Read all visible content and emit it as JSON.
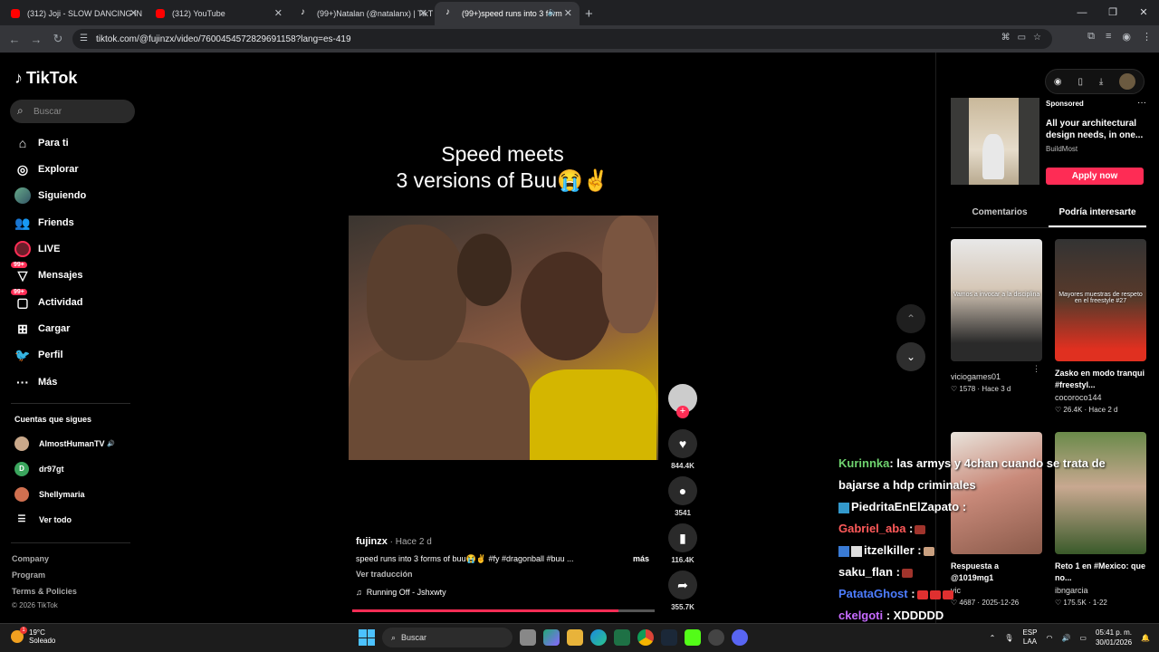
{
  "browser": {
    "tabs": [
      {
        "title": "(312) Joji - SLOW DANCING IN",
        "type": "yt",
        "active": false
      },
      {
        "title": "(312) YouTube",
        "type": "yt",
        "active": false
      },
      {
        "title": "(99+)Natalan (@natalanx) | TikT",
        "type": "tt",
        "active": false
      },
      {
        "title": "(99+)speed runs into 3 form",
        "type": "tt",
        "active": true
      }
    ],
    "url": "tiktok.com/@fujinzx/video/7600454572829691158?lang=es-419"
  },
  "sidebar": {
    "logo": "TikTok",
    "search_placeholder": "Buscar",
    "nav": [
      {
        "label": "Para ti",
        "icon": "home-icon"
      },
      {
        "label": "Explorar",
        "icon": "compass-icon"
      },
      {
        "label": "Siguiendo",
        "icon": "following-avatar-icon"
      },
      {
        "label": "Friends",
        "icon": "friends-icon"
      },
      {
        "label": "LIVE",
        "icon": "live-icon"
      },
      {
        "label": "Mensajes",
        "icon": "messages-icon",
        "badge": "99+"
      },
      {
        "label": "Actividad",
        "icon": "activity-icon",
        "badge": "99+"
      },
      {
        "label": "Cargar",
        "icon": "upload-icon"
      },
      {
        "label": "Perfil",
        "icon": "profile-icon"
      },
      {
        "label": "Más",
        "icon": "more-icon"
      }
    ],
    "following_title": "Cuentas que sigues",
    "following": [
      {
        "name": "AlmostHumanTV",
        "extra": "🔊"
      },
      {
        "name": "dr97gt",
        "initial": "D"
      },
      {
        "name": "Shellymaria"
      }
    ],
    "see_all": "Ver todo",
    "footer": [
      "Company",
      "Program",
      "Terms & Policies"
    ],
    "copyright": "© 2026 TikTok"
  },
  "video": {
    "caption_line1": "Speed meets",
    "caption_line2": "3 versions of Buu😭✌️",
    "author": "fujinzx",
    "time": " · Hace 2 d",
    "description": "speed runs into 3 forms of buu😭✌️ #fy #dragonball #buu ...",
    "more": "más",
    "translate": "Ver traducción",
    "music": "Running Off - Jshxwty",
    "progress": 0.88
  },
  "actions": {
    "likes": "844.4K",
    "comments": "3541",
    "saves": "116.4K",
    "shares": "355.7K"
  },
  "ad": {
    "sponsored": "Sponsored",
    "title": "All your architectural design needs, in one...",
    "brand": "BuildMost",
    "button": "Apply now"
  },
  "right_tabs": [
    "Comentarios",
    "Podría interesarte"
  ],
  "cards": [
    {
      "overlay": "Vamos a invocar a la disciplina",
      "title": "",
      "user": "viciogames01",
      "likes": "♡ 1578",
      "time": "Hace 3 d"
    },
    {
      "overlay": "Mayores muestras de respeto en el freestyle #27",
      "title": "Zasko en modo tranqui #freestyl...",
      "user": "cocoroco144",
      "likes": "♡ 26.4K",
      "time": "Hace 2 d"
    },
    {
      "overlay": "",
      "title": "Respuesta a @1019mg1",
      "user": "vic",
      "likes": "♡ 4687",
      "time": "2025-12-26"
    },
    {
      "overlay": "",
      "title": "Reto 1 en #Mexico: que no...",
      "user": "ibngarcia",
      "likes": "♡ 175.5K",
      "time": "1-22"
    }
  ],
  "chat": [
    {
      "user": "Kurinnka",
      "color": "#6fd36f",
      "text": ": las armys y 4chan cuando se trata de"
    },
    {
      "user": "",
      "color": "#ffffff",
      "text": "bajarse a hdp criminales"
    },
    {
      "user": "PiedritaEnElZapato",
      "color": "#ffffff",
      "text": " :"
    },
    {
      "user": "Gabriel_aba",
      "color": "#ff5a5a",
      "text": " :"
    },
    {
      "user": "itzelkiller",
      "color": "#ffffff",
      "text": " :"
    },
    {
      "user": "saku_flan",
      "color": "#ffffff",
      "text": " :"
    },
    {
      "user": "PatataGhost",
      "color": "#4d7dff",
      "text": " :"
    },
    {
      "user": "ckelgoti",
      "color": "#c76bff",
      "text": " : XDDDDD"
    }
  ],
  "taskbar": {
    "temp": "19°C",
    "weather": "Soleado",
    "search": "Buscar",
    "lang1": "ESP",
    "lang2": "LAA",
    "time": "05:41 p. m.",
    "date": "30/01/2026"
  }
}
